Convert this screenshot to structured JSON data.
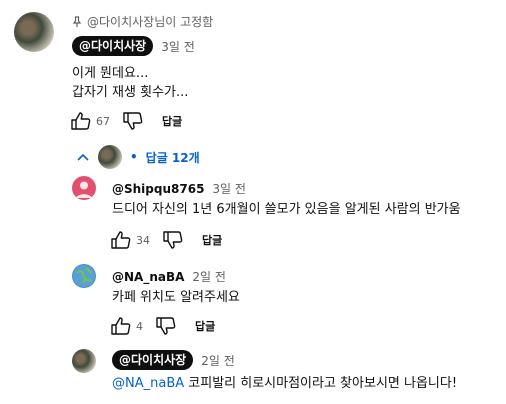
{
  "pinned": {
    "pin_icon": "pin-icon",
    "pin_text": "@다이치사장님이 고정함",
    "author": "@다이치사장",
    "time": "3일 전",
    "lines": [
      "이게 뭔데요...",
      "갑자기 재생 횟수가..."
    ],
    "like_count": "67",
    "reply_label": "답글"
  },
  "replies_toggle": {
    "label": "답글 12개",
    "bullet": "•"
  },
  "replies": [
    {
      "author": "@Shipqu8765",
      "time": "3일 전",
      "text": "드디어 자신의 1년 6개월이 쓸모가 있음을 알게된 사람의 반가움",
      "like_count": "34",
      "reply_label": "답글",
      "avatar_color": "#e3506d"
    },
    {
      "author": "@NA_naBA",
      "time": "2일 전",
      "text": "카페 위치도 알려주세요",
      "like_count": "4",
      "reply_label": "답글",
      "avatar_color": "#4a90c8"
    },
    {
      "author": "@다이치사장",
      "time": "2일 전",
      "mention": "@NA_naBA",
      "text": " 코피발리 히로시마점이라고 찾아보시면 나옵니다!"
    }
  ]
}
